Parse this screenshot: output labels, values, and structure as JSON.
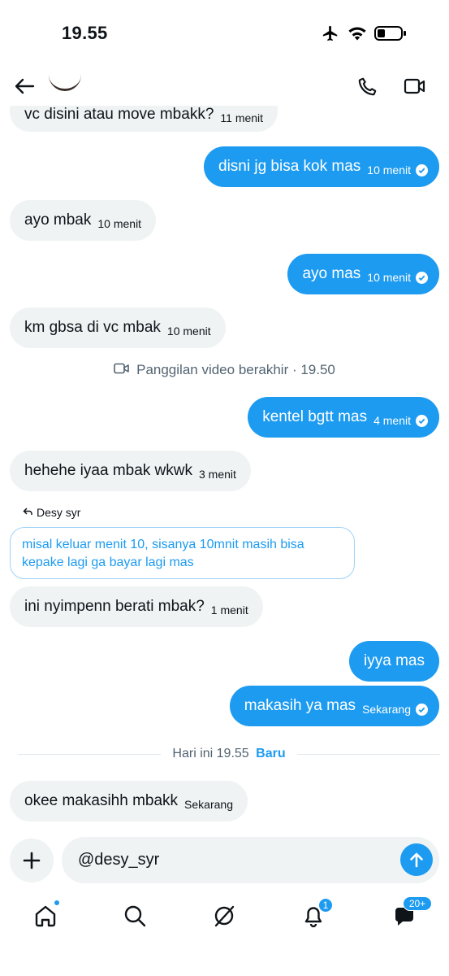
{
  "status": {
    "time": "19.55"
  },
  "messages": [
    {
      "dir": "in",
      "text": "vc disini atau move mbakk?",
      "time": "11 menit"
    },
    {
      "dir": "out",
      "text": "disni jg bisa kok mas",
      "time": "10 menit"
    },
    {
      "dir": "in",
      "text": "ayo mbak",
      "time": "10 menit"
    },
    {
      "dir": "out",
      "text": "ayo mas",
      "time": "10 menit"
    },
    {
      "dir": "in",
      "text": "km gbsa di vc mbak",
      "time": "10 menit"
    },
    {
      "dir": "out",
      "text": "kentel bgtt mas",
      "time": "4 menit"
    },
    {
      "dir": "in",
      "text": "hehehe iyaa mbak wkwk",
      "time": "3 menit"
    },
    {
      "dir": "in",
      "text": "ini nyimpenn berati mbak?",
      "time": "1 menit"
    },
    {
      "dir": "out",
      "text": "iyya mas",
      "time": ""
    },
    {
      "dir": "out",
      "text": "makasih ya mas",
      "time": "Sekarang"
    },
    {
      "dir": "in",
      "text": "okee makasihh mbakk",
      "time": "Sekarang"
    }
  ],
  "system_event": {
    "text": "Panggilan video berakhir · 19.50",
    "icon": "video-icon"
  },
  "reply": {
    "to_name": "Desy syr",
    "quoted_line1": "misal keluar menit 10, sisanya 10mnit masih bisa",
    "quoted_line2": "kepake lagi ga bayar lagi mas"
  },
  "divider": {
    "label": "Hari ini 19.55",
    "new_label": "Baru"
  },
  "composer": {
    "value": "@desy_syr"
  },
  "nav": {
    "notifications_badge": "1",
    "messages_badge": "20+"
  },
  "colors": {
    "accent": "#1d9bf0",
    "incoming_bubble": "#eff3f4",
    "secondary_text": "#536471"
  }
}
